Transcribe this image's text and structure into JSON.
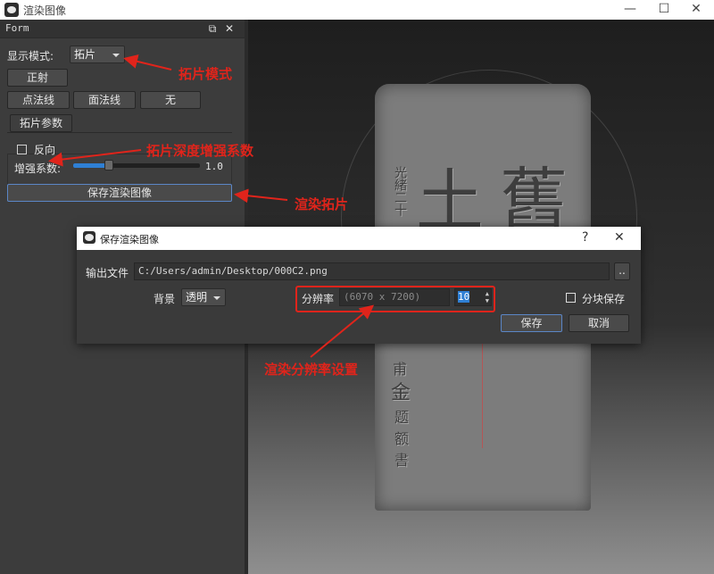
{
  "window": {
    "title": "渲染图像",
    "minimize": "—",
    "maximize": "☐",
    "close": "✕"
  },
  "dock": {
    "title": "Form",
    "float_icon": "⧉",
    "close_icon": "✕",
    "display_mode_label": "显示模式:",
    "display_mode_value": "拓片",
    "btn_front": "正射",
    "btn_point_normal": "点法线",
    "btn_face_normal": "面法线",
    "btn_none": "无",
    "tab_params": "拓片参数",
    "reverse_label": "反向",
    "reverse_checked": false,
    "enhance_label": "增强系数:",
    "enhance_value": "1.0",
    "enhance_fraction": 0.28,
    "save_button": "保存渲染图像"
  },
  "viewport": {
    "stele_marks": [
      "光緒二十",
      "土",
      "舊",
      "甫",
      "金",
      "题",
      "额",
      "書"
    ],
    "colors": {
      "accent_red": "#e0241b"
    }
  },
  "dialog": {
    "title": "保存渲染图像",
    "help": "?",
    "close": "✕",
    "output_label": "输出文件",
    "output_path": "C:/Users/admin/Desktop/000C2.png",
    "browse": "..",
    "background_label": "背景",
    "background_value": "透明",
    "resolution_label": "分辨率",
    "resolution_value": "(6070 x 7200)",
    "scale_value": "10",
    "tile_save_label": "分块保存",
    "tile_save_checked": false,
    "save": "保存",
    "cancel": "取消"
  },
  "annotations": {
    "rubbing_mode": "拓片模式",
    "depth_coef": "拓片深度增强系数",
    "render_rubbing": "渲染拓片",
    "resolution_setting": "渲染分辨率设置"
  }
}
